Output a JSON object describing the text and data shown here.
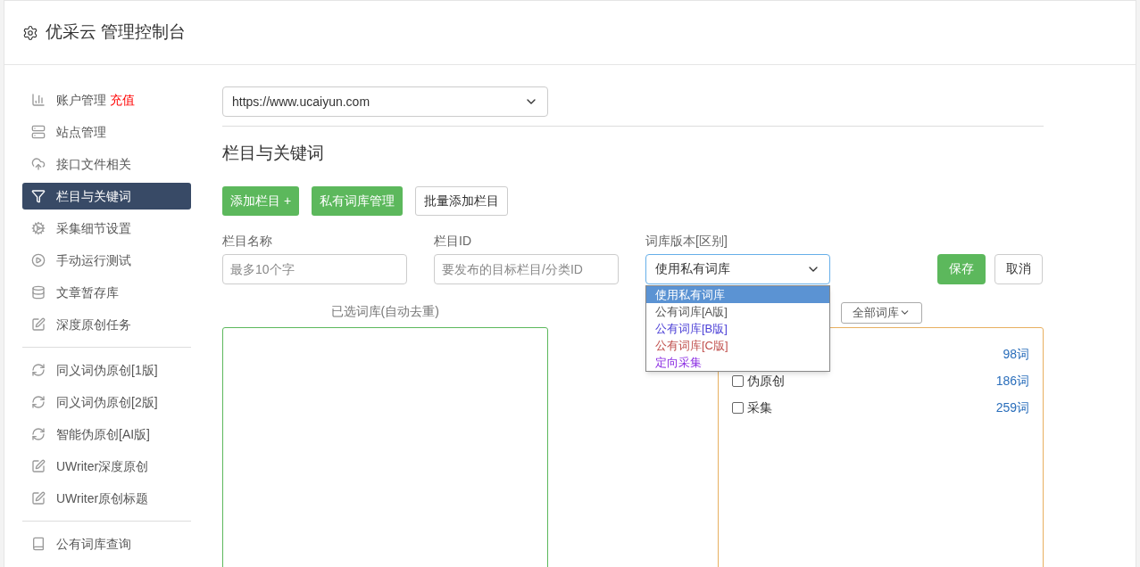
{
  "header": {
    "title": "优采云 管理控制台"
  },
  "sidebar": {
    "groups": [
      [
        {
          "kind": "chart",
          "label": "账户管理",
          "badge": "充值",
          "selected": false
        },
        {
          "kind": "server",
          "label": "站点管理",
          "selected": false
        },
        {
          "kind": "cloud",
          "label": "接口文件相关",
          "selected": false
        },
        {
          "kind": "filter",
          "label": "栏目与关键词",
          "selected": true
        },
        {
          "kind": "gears",
          "label": "采集细节设置",
          "selected": false
        },
        {
          "kind": "play",
          "label": "手动运行测试",
          "selected": false
        },
        {
          "kind": "database",
          "label": "文章暂存库",
          "selected": false
        },
        {
          "kind": "edit",
          "label": "深度原创任务",
          "selected": false
        }
      ],
      [
        {
          "kind": "refresh",
          "label": "同义词伪原创[1版]",
          "selected": false
        },
        {
          "kind": "refresh",
          "label": "同义词伪原创[2版]",
          "selected": false
        },
        {
          "kind": "refresh",
          "label": "智能伪原创[AI版]",
          "selected": false
        },
        {
          "kind": "edit",
          "label": "UWriter深度原创",
          "selected": false
        },
        {
          "kind": "edit",
          "label": "UWriter原创标题",
          "selected": false
        }
      ],
      [
        {
          "kind": "book",
          "label": "公有词库查询",
          "selected": false
        }
      ]
    ]
  },
  "site_select": {
    "value": "https://www.ucaiyun.com"
  },
  "section_title": "栏目与关键词",
  "actions": [
    {
      "label": "添加栏目 +",
      "kind": "primary"
    },
    {
      "label": "私有词库管理",
      "kind": "primary"
    },
    {
      "label": "批量添加栏目",
      "kind": "default"
    }
  ],
  "form": {
    "name": {
      "label": "栏目名称",
      "placeholder": "最多10个字"
    },
    "id": {
      "label": "栏目ID",
      "placeholder": "要发布的目标栏目/分类ID"
    },
    "version": {
      "label": "词库版本[区别]",
      "value": "使用私有词库",
      "expanded": true,
      "options": [
        {
          "label": "使用私有词库",
          "selected": true
        },
        {
          "label": "公有词库[A版]",
          "selected": false,
          "color": "#555555"
        },
        {
          "label": "公有词库[B版]",
          "selected": false,
          "color": "#4b3fd6"
        },
        {
          "label": "公有词库[C版]",
          "selected": false,
          "color": "#c0504d"
        },
        {
          "label": "定向采集",
          "selected": false,
          "color": "#8a2be2"
        }
      ]
    },
    "save": "保存",
    "cancel": "取消"
  },
  "selected_panel": {
    "title": "已选词库(自动去重)"
  },
  "library_panel": {
    "filter": "全部词库",
    "rows": [
      {
        "count": "98词"
      },
      {
        "label": "伪原创",
        "count": "186词",
        "checked": false
      },
      {
        "label": "采集",
        "count": "259词",
        "checked": false
      }
    ]
  }
}
